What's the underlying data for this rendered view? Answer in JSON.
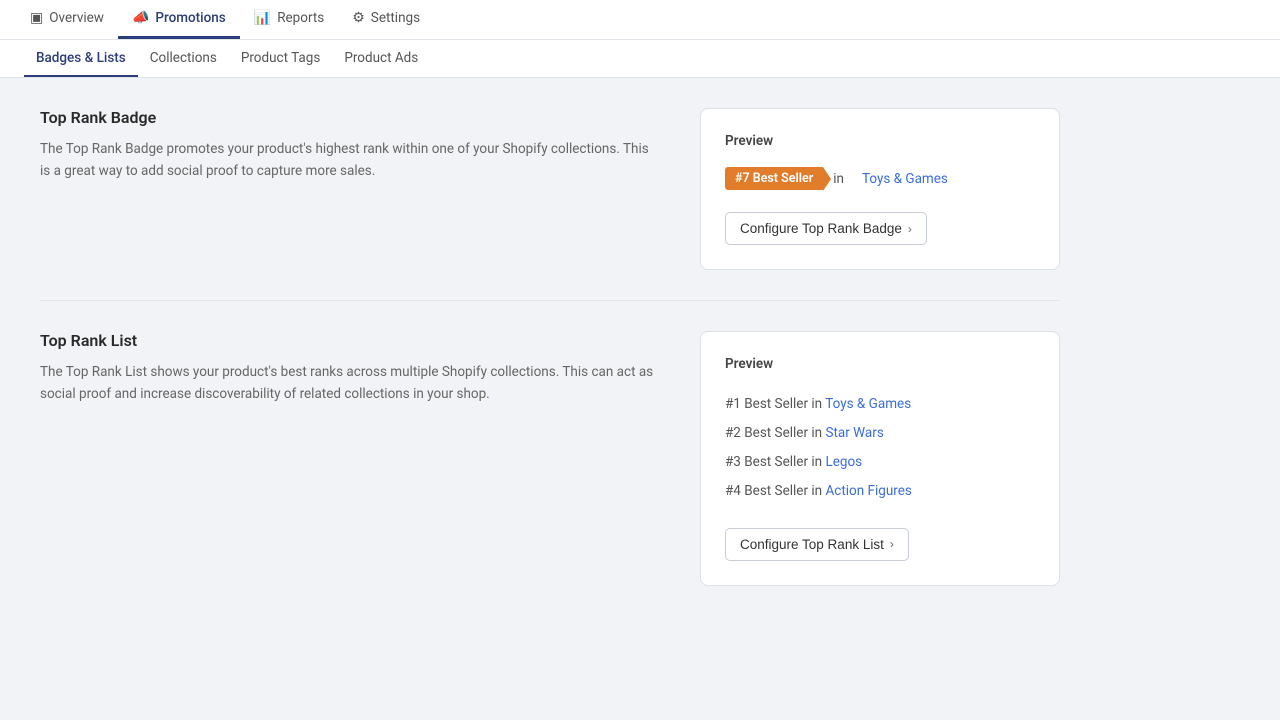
{
  "nav": {
    "items": [
      {
        "id": "overview",
        "label": "Overview",
        "icon": "▣",
        "active": false
      },
      {
        "id": "promotions",
        "label": "Promotions",
        "icon": "📣",
        "active": true
      },
      {
        "id": "reports",
        "label": "Reports",
        "icon": "📊",
        "active": false
      },
      {
        "id": "settings",
        "label": "Settings",
        "icon": "⚙",
        "active": false
      }
    ]
  },
  "subnav": {
    "items": [
      {
        "id": "badges-lists",
        "label": "Badges & Lists",
        "active": true
      },
      {
        "id": "collections",
        "label": "Collections",
        "active": false
      },
      {
        "id": "product-tags",
        "label": "Product Tags",
        "active": false
      },
      {
        "id": "product-ads",
        "label": "Product Ads",
        "active": false
      }
    ]
  },
  "badge_section": {
    "title": "Top Rank Badge",
    "description": "The Top Rank Badge promotes your product's highest rank within one of your Shopify collections. This is a great way to add social proof to capture more sales.",
    "preview": {
      "label": "Preview",
      "badge_text": "#7 Best Seller",
      "in_text": "in",
      "collection_link": "Toys & Games"
    },
    "configure_btn": "Configure Top Rank Badge"
  },
  "list_section": {
    "title": "Top Rank List",
    "description": "The Top Rank List shows your product's best ranks across multiple Shopify collections. This can act as social proof and increase discoverability of related collections in your shop.",
    "preview": {
      "label": "Preview",
      "items": [
        {
          "rank": "#1 Best Seller in",
          "collection": "Toys & Games"
        },
        {
          "rank": "#2 Best Seller in",
          "collection": "Star Wars"
        },
        {
          "rank": "#3 Best Seller in",
          "collection": "Legos"
        },
        {
          "rank": "#4 Best Seller in",
          "collection": "Action Figures"
        }
      ]
    },
    "configure_btn": "Configure Top Rank List"
  }
}
